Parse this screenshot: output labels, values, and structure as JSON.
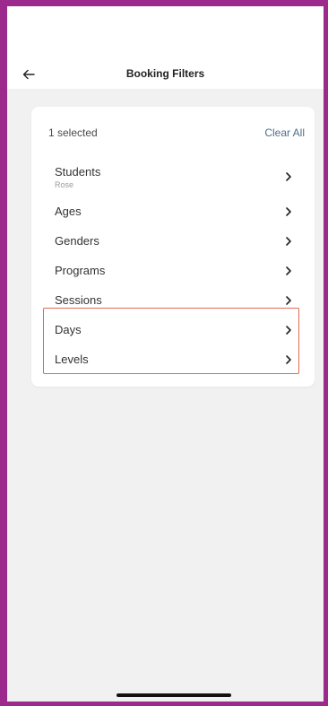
{
  "header": {
    "title": "Booking Filters",
    "back_icon": "arrow-left-icon"
  },
  "summary": {
    "selected_text": "1 selected",
    "clear_all_label": "Clear All"
  },
  "filters": [
    {
      "label": "Students",
      "sub": "Rose"
    },
    {
      "label": "Ages"
    },
    {
      "label": "Genders"
    },
    {
      "label": "Programs"
    },
    {
      "label": "Sessions"
    },
    {
      "label": "Days"
    },
    {
      "label": "Levels"
    }
  ],
  "colors": {
    "frame": "#9b2a8c",
    "highlight": "#e06a52",
    "link": "#4d6d8c",
    "background": "#f1f1f2"
  }
}
